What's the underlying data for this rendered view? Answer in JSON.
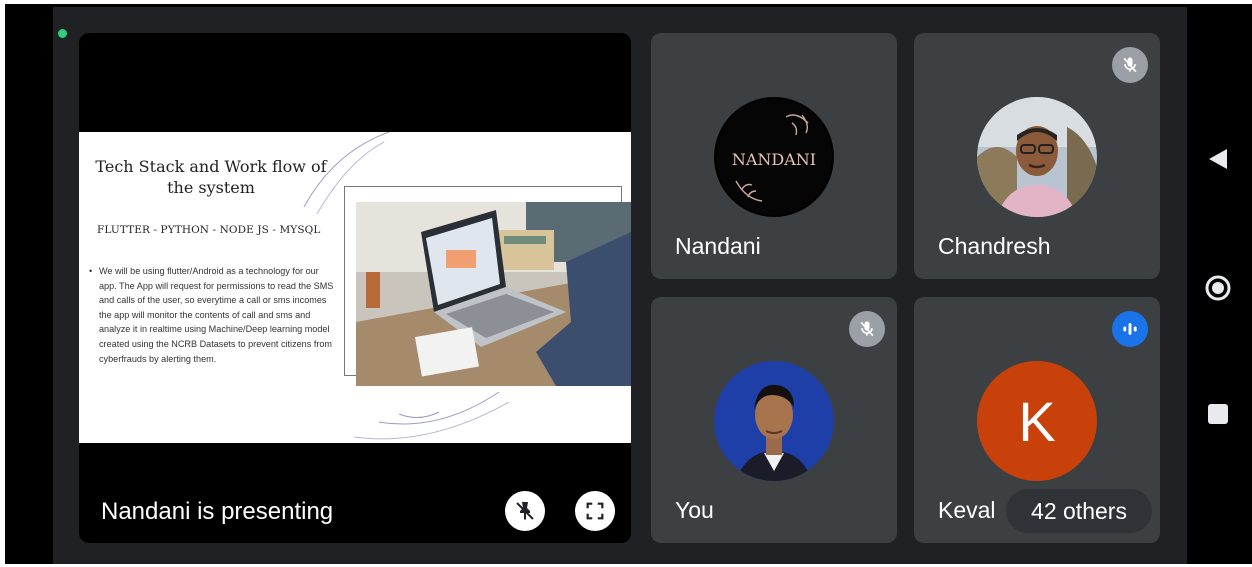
{
  "presentation": {
    "caption": "Nandani is presenting",
    "slide": {
      "title_line1": "Tech Stack and Work flow of",
      "title_line2": "the system",
      "stack": "FLUTTER - PYTHON - NODE JS - MYSQL",
      "bullet": "We will be using flutter/Android as a technology for our app. The App will request for permissions to read the SMS and calls of the user, so everytime a call or sms incomes the app will monitor the contents of call and sms and analyze it in realtime using Machine/Deep learning model created using the NCRB Datasets to prevent citizens from cyberfrauds by alerting them."
    },
    "buttons": [
      {
        "icon": "unpin-icon"
      },
      {
        "icon": "fullscreen-icon"
      }
    ]
  },
  "participants": [
    {
      "name": "Nandani",
      "avatar_text": "NANDANI",
      "mic": "none"
    },
    {
      "name": "Chandresh",
      "mic": "muted"
    },
    {
      "name": "You",
      "mic": "muted"
    },
    {
      "name": "Keval",
      "initial": "K",
      "mic": "speaking",
      "avatar_color": "#c8410b"
    }
  ],
  "others": {
    "label": "42 others"
  },
  "navbar": {
    "buttons": [
      "back-icon",
      "home-icon",
      "recents-icon"
    ]
  },
  "colors": {
    "meet_bg": "#202124",
    "tile_bg": "#3c4043",
    "status": "#2ecf7a",
    "speaking": "#1a73e8"
  }
}
